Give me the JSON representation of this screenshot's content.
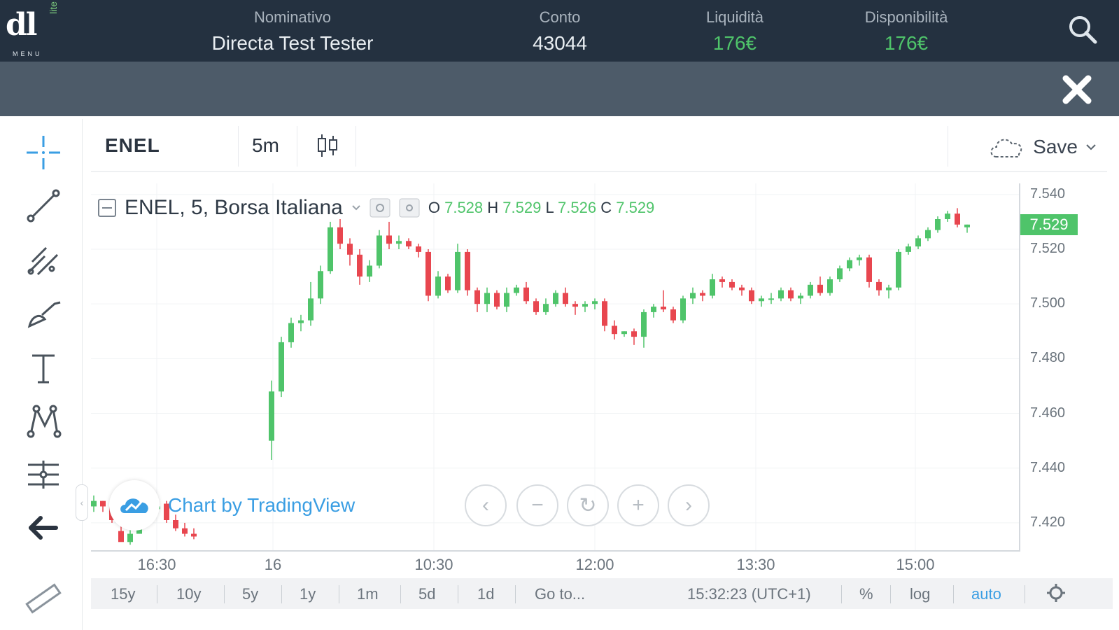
{
  "header": {
    "logo_text": "dl",
    "logo_sub": "lite",
    "menu_label": "MENU",
    "fields": [
      {
        "label": "Nominativo",
        "value": "Directa Test Tester"
      },
      {
        "label": "Conto",
        "value": "43044"
      },
      {
        "label": "Liquidità",
        "value": "176€"
      },
      {
        "label": "Disponibilità",
        "value": "176€"
      }
    ]
  },
  "toolbar": {
    "symbol": "ENEL",
    "interval": "5m",
    "save_label": "Save"
  },
  "legend": {
    "title": "ENEL, 5, Borsa Italiana",
    "o_label": "O",
    "o_value": "7.528",
    "h_label": "H",
    "h_value": "7.529",
    "l_label": "L",
    "l_value": "7.526",
    "c_label": "C",
    "c_value": "7.529"
  },
  "watermark": {
    "text": "Chart by TradingView"
  },
  "bottom_bar": {
    "ranges": [
      "15y",
      "10y",
      "5y",
      "1y",
      "1m",
      "5d",
      "1d"
    ],
    "goto": "Go to...",
    "time": "15:32:23 (UTC+1)",
    "percent": "%",
    "log": "log",
    "auto": "auto"
  },
  "colors": {
    "up": "#4fc46a",
    "down": "#e8464f",
    "accent": "#3a9ee3",
    "header_bg": "#243140"
  },
  "chart_data": {
    "type": "candlestick",
    "title": "ENEL, 5, Borsa Italiana",
    "x_tick_labels": [
      "16:30",
      "16",
      "10:30",
      "12:00",
      "13:30",
      "15:00"
    ],
    "y_tick_labels": [
      "7.540",
      "7.520",
      "7.500",
      "7.480",
      "7.460",
      "7.440",
      "7.420"
    ],
    "ylim": [
      7.41,
      7.542
    ],
    "last_price": "7.529",
    "candles": [
      [
        7.426,
        7.43,
        7.424,
        7.428
      ],
      [
        7.428,
        7.428,
        7.424,
        7.426
      ],
      [
        7.426,
        7.427,
        7.42,
        7.421
      ],
      [
        7.417,
        7.42,
        7.414,
        7.413
      ],
      [
        7.413,
        7.418,
        7.412,
        7.416
      ],
      [
        7.416,
        7.424,
        7.416,
        7.423
      ],
      [
        7.423,
        7.426,
        7.421,
        7.425
      ],
      [
        7.425,
        7.427,
        7.424,
        7.426
      ],
      [
        7.427,
        7.428,
        7.42,
        7.421
      ],
      [
        7.421,
        7.423,
        7.417,
        7.418
      ],
      [
        7.418,
        7.42,
        7.415,
        7.416
      ],
      [
        7.416,
        7.418,
        7.414,
        7.415
      ],
      [
        7.45,
        7.472,
        7.443,
        7.468
      ],
      [
        7.468,
        7.488,
        7.466,
        7.486
      ],
      [
        7.486,
        7.495,
        7.484,
        7.493
      ],
      [
        7.493,
        7.496,
        7.49,
        7.494
      ],
      [
        7.494,
        7.508,
        7.492,
        7.502
      ],
      [
        7.502,
        7.514,
        7.5,
        7.512
      ],
      [
        7.512,
        7.53,
        7.511,
        7.528
      ],
      [
        7.528,
        7.531,
        7.52,
        7.522
      ],
      [
        7.522,
        7.524,
        7.514,
        7.518
      ],
      [
        7.518,
        7.52,
        7.507,
        7.51
      ],
      [
        7.51,
        7.516,
        7.508,
        7.514
      ],
      [
        7.514,
        7.527,
        7.513,
        7.525
      ],
      [
        7.525,
        7.53,
        7.52,
        7.522
      ],
      [
        7.522,
        7.525,
        7.52,
        7.523
      ],
      [
        7.523,
        7.524,
        7.52,
        7.521
      ],
      [
        7.521,
        7.522,
        7.517,
        7.519
      ],
      [
        7.519,
        7.52,
        7.501,
        7.503
      ],
      [
        7.503,
        7.512,
        7.502,
        7.51
      ],
      [
        7.51,
        7.511,
        7.504,
        7.505
      ],
      [
        7.505,
        7.522,
        7.504,
        7.519
      ],
      [
        7.519,
        7.52,
        7.503,
        7.505
      ],
      [
        7.505,
        7.506,
        7.497,
        7.5
      ],
      [
        7.5,
        7.506,
        7.497,
        7.504
      ],
      [
        7.504,
        7.505,
        7.498,
        7.499
      ],
      [
        7.499,
        7.506,
        7.497,
        7.504
      ],
      [
        7.504,
        7.507,
        7.503,
        7.506
      ],
      [
        7.506,
        7.508,
        7.5,
        7.501
      ],
      [
        7.501,
        7.502,
        7.496,
        7.497
      ],
      [
        7.497,
        7.502,
        7.496,
        7.5
      ],
      [
        7.5,
        7.505,
        7.499,
        7.504
      ],
      [
        7.504,
        7.506,
        7.499,
        7.5
      ],
      [
        7.5,
        7.501,
        7.496,
        7.499
      ],
      [
        7.499,
        7.501,
        7.497,
        7.5
      ],
      [
        7.5,
        7.502,
        7.498,
        7.501
      ],
      [
        7.501,
        7.502,
        7.49,
        7.492
      ],
      [
        7.492,
        7.494,
        7.487,
        7.489
      ],
      [
        7.489,
        7.49,
        7.488,
        7.49
      ],
      [
        7.49,
        7.491,
        7.485,
        7.488
      ],
      [
        7.488,
        7.498,
        7.484,
        7.497
      ],
      [
        7.497,
        7.5,
        7.495,
        7.499
      ],
      [
        7.499,
        7.505,
        7.497,
        7.498
      ],
      [
        7.498,
        7.499,
        7.493,
        7.494
      ],
      [
        7.494,
        7.503,
        7.493,
        7.502
      ],
      [
        7.502,
        7.506,
        7.5,
        7.504
      ],
      [
        7.504,
        7.505,
        7.501,
        7.503
      ],
      [
        7.503,
        7.511,
        7.502,
        7.509
      ],
      [
        7.509,
        7.51,
        7.506,
        7.508
      ],
      [
        7.508,
        7.509,
        7.505,
        7.506
      ],
      [
        7.506,
        7.507,
        7.503,
        7.505
      ],
      [
        7.505,
        7.506,
        7.5,
        7.501
      ],
      [
        7.501,
        7.503,
        7.499,
        7.502
      ],
      [
        7.502,
        7.504,
        7.5,
        7.502
      ],
      [
        7.502,
        7.506,
        7.501,
        7.505
      ],
      [
        7.505,
        7.506,
        7.501,
        7.502
      ],
      [
        7.502,
        7.504,
        7.5,
        7.503
      ],
      [
        7.503,
        7.508,
        7.502,
        7.507
      ],
      [
        7.507,
        7.51,
        7.503,
        7.504
      ],
      [
        7.504,
        7.51,
        7.503,
        7.509
      ],
      [
        7.509,
        7.514,
        7.508,
        7.513
      ],
      [
        7.513,
        7.517,
        7.512,
        7.516
      ],
      [
        7.516,
        7.518,
        7.514,
        7.517
      ],
      [
        7.517,
        7.518,
        7.506,
        7.508
      ],
      [
        7.508,
        7.509,
        7.503,
        7.505
      ],
      [
        7.505,
        7.507,
        7.502,
        7.506
      ],
      [
        7.506,
        7.52,
        7.505,
        7.519
      ],
      [
        7.519,
        7.522,
        7.518,
        7.521
      ],
      [
        7.521,
        7.525,
        7.52,
        7.524
      ],
      [
        7.524,
        7.528,
        7.523,
        7.527
      ],
      [
        7.527,
        7.532,
        7.526,
        7.531
      ],
      [
        7.531,
        7.534,
        7.53,
        7.533
      ],
      [
        7.533,
        7.535,
        7.528,
        7.529
      ],
      [
        7.528,
        7.529,
        7.526,
        7.529
      ]
    ]
  }
}
